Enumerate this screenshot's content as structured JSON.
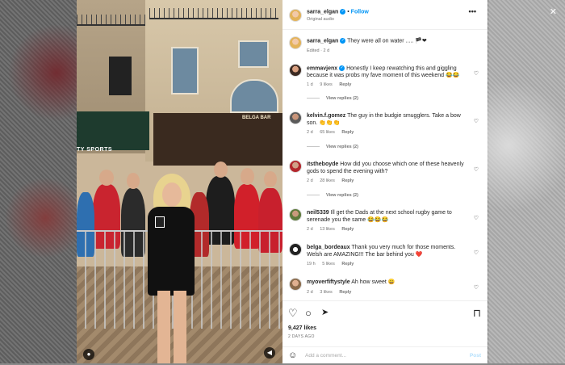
{
  "post": {
    "author": "sarra_elgan",
    "follow_label": "Follow",
    "audio": "Original audio",
    "caption_author": "sarra_elgan",
    "caption_text": "They were all on water .....",
    "caption_emoji": "🏴❤",
    "caption_meta": "Edited · 2 d",
    "more_label": "•••",
    "media_signs": {
      "left_awning": "TY SPORTS",
      "bar_sign": "BELGA BAR"
    }
  },
  "comments": [
    {
      "user": "emmavjenx",
      "verified": true,
      "text": "Honestly I keep rewatching this and giggling because it was probs my fave moment of this weekend 😂😂",
      "time": "1 d",
      "likes": "9 likes",
      "reply": "Reply",
      "view_replies": "View replies (2)"
    },
    {
      "user": "kelvin.f.gomez",
      "verified": false,
      "text": "The guy in the budgie smugglers. Take a bow son. 👏👏👏",
      "time": "2 d",
      "likes": "65 likes",
      "reply": "Reply",
      "view_replies": "View replies (2)"
    },
    {
      "user": "itstheboyde",
      "verified": false,
      "text": "How did you choose which one of these heavenly gods to spend the evening with?",
      "time": "2 d",
      "likes": "28 likes",
      "reply": "Reply",
      "view_replies": "View replies (2)"
    },
    {
      "user": "neil5339",
      "verified": false,
      "text": "Ill get the Dads at the next school rugby game to serenade you the same 😂😂😂",
      "time": "2 d",
      "likes": "13 likes",
      "reply": "Reply",
      "view_replies": ""
    },
    {
      "user": "belga_bordeaux",
      "verified": false,
      "text": "Thank you very much for those moments. Welsh are AMAZING!!! The bar behind you ❤️",
      "time": "19 h",
      "likes": "5 likes",
      "reply": "Reply",
      "view_replies": ""
    },
    {
      "user": "myoverfiftystyle",
      "verified": false,
      "text": "Ah how sweet 😄",
      "time": "2 d",
      "likes": "3 likes",
      "reply": "Reply",
      "view_replies": ""
    }
  ],
  "footer": {
    "likes": "9,427 likes",
    "date": "2 DAYS AGO",
    "add_placeholder": "Add a comment...",
    "post_label": "Post"
  },
  "icons": {
    "heart": "♡",
    "comment": "○",
    "share": "➤",
    "save": "⊓",
    "emoji": "☺",
    "close": "✕"
  },
  "colors": {
    "accent": "#0095f6",
    "text": "#262626",
    "muted": "#737373"
  }
}
